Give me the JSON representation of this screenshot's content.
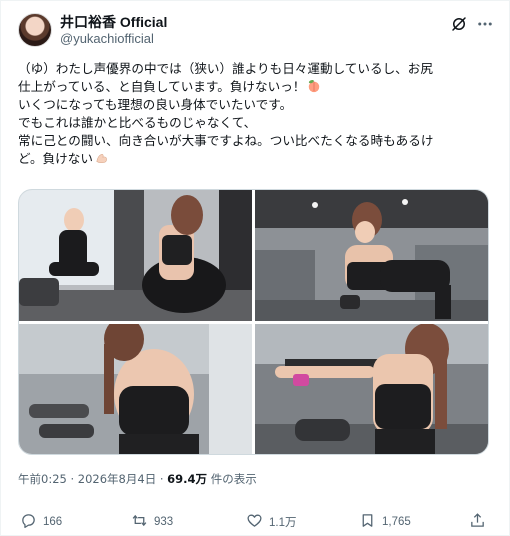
{
  "author": {
    "display_name": "井口裕香 Official",
    "handle": "@yukachiofficial"
  },
  "tweet": {
    "lines": [
      "（ゆ）わたし声優界の中では（狭い）誰よりも日々運動しているし、お尻",
      "仕上がっている、と自負しています。負けないっ！",
      "いくつになっても理想の良い身体でいたいです。",
      "でもこれは誰かと比べるものじゃなくて、",
      "常に己との闘い、向き合いが大事ですよね。つい比べたくなる時もあるけ",
      "ど。負けない"
    ],
    "emojis": [
      "peach-emoji",
      "flexed-biceps-emoji"
    ]
  },
  "meta": {
    "time": "午前0:25 · 2026年8月4日 · ",
    "views_count": "69.4万",
    "views_label": " 件の表示"
  },
  "actions": {
    "replies": "166",
    "reposts": "933",
    "likes": "1.1万",
    "bookmarks": "1,765"
  },
  "colors": {
    "text": "#0f1419",
    "secondary": "#536471",
    "border": "#cfd9de"
  },
  "icons": [
    "grok-icon",
    "more-icon",
    "reply-icon",
    "repost-icon",
    "like-icon",
    "bookmark-icon",
    "share-icon"
  ]
}
